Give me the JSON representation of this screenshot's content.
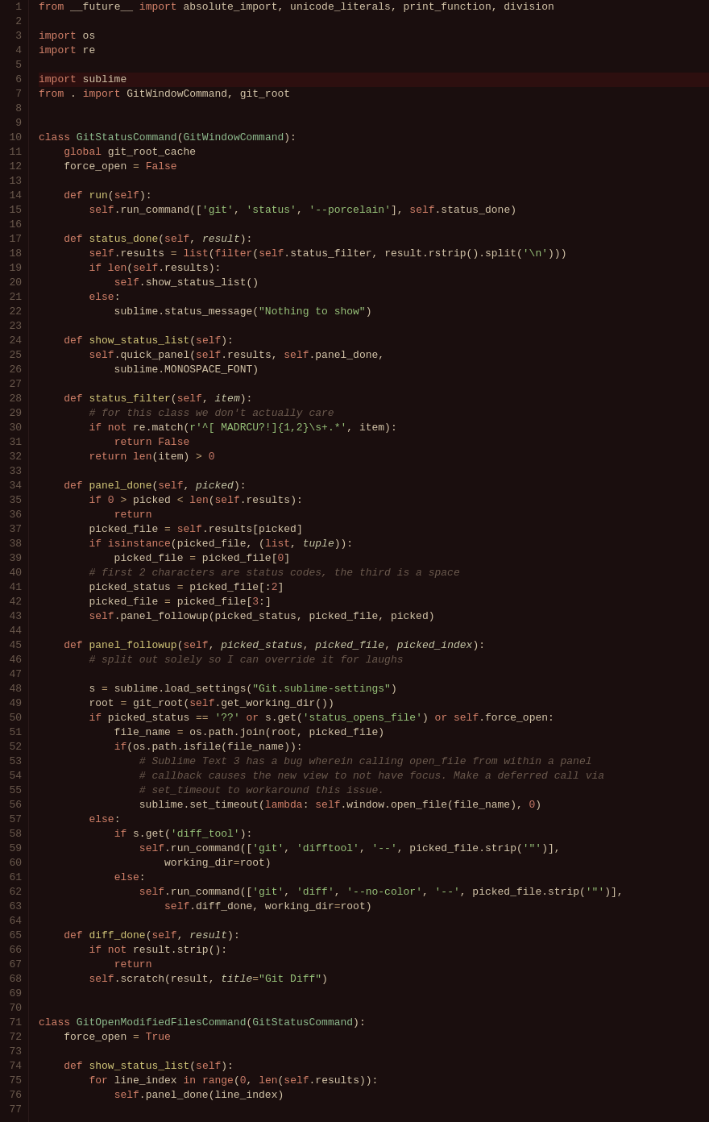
{
  "lines": [
    {
      "num": 1,
      "html": "<span class='kw'>from</span> __future__ <span class='kw'>import</span> absolute_import, unicode_literals, print_function, division",
      "highlight": false
    },
    {
      "num": 2,
      "html": "",
      "highlight": false
    },
    {
      "num": 3,
      "html": "<span class='kw'>import</span> os",
      "highlight": false
    },
    {
      "num": 4,
      "html": "<span class='kw'>import</span> re",
      "highlight": false
    },
    {
      "num": 5,
      "html": "",
      "highlight": false
    },
    {
      "num": 6,
      "html": "<span class='kw'>import</span> sublime",
      "highlight": true
    },
    {
      "num": 7,
      "html": "<span class='kw'>from</span> . <span class='kw'>import</span> GitWindowCommand, git_root",
      "highlight": false
    },
    {
      "num": 8,
      "html": "",
      "highlight": false
    },
    {
      "num": 9,
      "html": "",
      "highlight": false
    },
    {
      "num": 10,
      "html": "<span class='kw'>class</span> <span class='cn'>GitStatusCommand</span>(<span class='cn'>GitWindowCommand</span>):",
      "highlight": false
    },
    {
      "num": 11,
      "html": "    <span class='kw'>global</span> git_root_cache",
      "highlight": false
    },
    {
      "num": 12,
      "html": "    force_open <span class='op'>=</span> <span class='bool'>False</span>",
      "highlight": false
    },
    {
      "num": 13,
      "html": "",
      "highlight": false
    },
    {
      "num": 14,
      "html": "    <span class='kw'>def</span> <span class='fn'>run</span>(<span class='self-kw'>self</span>):",
      "highlight": false
    },
    {
      "num": 15,
      "html": "        <span class='self-kw'>self</span>.run_command([<span class='str'>'git'</span>, <span class='str'>'status'</span>, <span class='str'>'--porcelain'</span>], <span class='self-kw'>self</span>.status_done)",
      "highlight": false
    },
    {
      "num": 16,
      "html": "",
      "highlight": false
    },
    {
      "num": 17,
      "html": "    <span class='kw'>def</span> <span class='fn'>status_done</span>(<span class='self-kw'>self</span>, <span class='param'>result</span>):",
      "highlight": false
    },
    {
      "num": 18,
      "html": "        <span class='self-kw'>self</span>.results <span class='op'>=</span> <span class='bi'>list</span>(<span class='bi'>filter</span>(<span class='self-kw'>self</span>.status_filter, result.rstrip().split(<span class='str'>'\\n'</span>)))",
      "highlight": false
    },
    {
      "num": 19,
      "html": "        <span class='kw'>if</span> <span class='bi'>len</span>(<span class='self-kw'>self</span>.results):",
      "highlight": false
    },
    {
      "num": 20,
      "html": "            <span class='self-kw'>self</span>.show_status_list()",
      "highlight": false
    },
    {
      "num": 21,
      "html": "        <span class='kw'>else</span>:",
      "highlight": false
    },
    {
      "num": 22,
      "html": "            sublime.status_message(<span class='str'>\"Nothing to show\"</span>)",
      "highlight": false
    },
    {
      "num": 23,
      "html": "",
      "highlight": false
    },
    {
      "num": 24,
      "html": "    <span class='kw'>def</span> <span class='fn'>show_status_list</span>(<span class='self-kw'>self</span>):",
      "highlight": false
    },
    {
      "num": 25,
      "html": "        <span class='self-kw'>self</span>.quick_panel(<span class='self-kw'>self</span>.results, <span class='self-kw'>self</span>.panel_done,",
      "highlight": false
    },
    {
      "num": 26,
      "html": "            sublime.MONOSPACE_FONT)",
      "highlight": false
    },
    {
      "num": 27,
      "html": "",
      "highlight": false
    },
    {
      "num": 28,
      "html": "    <span class='kw'>def</span> <span class='fn'>status_filter</span>(<span class='self-kw'>self</span>, <span class='param'>item</span>):",
      "highlight": false
    },
    {
      "num": 29,
      "html": "        <span class='cm'># for this class we don't actually care</span>",
      "highlight": false
    },
    {
      "num": 30,
      "html": "        <span class='kw'>if not</span> re.match(<span class='str'>r'^[ MADRCU?!]{1,2}\\s+.*'</span>, item):",
      "highlight": false
    },
    {
      "num": 31,
      "html": "            <span class='kw'>return</span> <span class='bool'>False</span>",
      "highlight": false
    },
    {
      "num": 32,
      "html": "        <span class='kw'>return</span> <span class='bi'>len</span>(item) <span class='op'>&gt;</span> <span class='num'>0</span>",
      "highlight": false
    },
    {
      "num": 33,
      "html": "",
      "highlight": false
    },
    {
      "num": 34,
      "html": "    <span class='kw'>def</span> <span class='fn'>panel_done</span>(<span class='self-kw'>self</span>, <span class='param'>picked</span>):",
      "highlight": false
    },
    {
      "num": 35,
      "html": "        <span class='kw'>if</span> <span class='num'>0</span> <span class='op'>&gt;</span> picked <span class='op'>&lt;</span> <span class='bi'>len</span>(<span class='self-kw'>self</span>.results):",
      "highlight": false
    },
    {
      "num": 36,
      "html": "            <span class='kw'>return</span>",
      "highlight": false
    },
    {
      "num": 37,
      "html": "        picked_file <span class='op'>=</span> <span class='self-kw'>self</span>.results[picked]",
      "highlight": false
    },
    {
      "num": 38,
      "html": "        <span class='kw'>if</span> <span class='bi'>isinstance</span>(picked_file, (<span class='bi'>list</span>, <span class='param'>tuple</span>)):",
      "highlight": false
    },
    {
      "num": 39,
      "html": "            picked_file <span class='op'>=</span> picked_file[<span class='num'>0</span>]",
      "highlight": false
    },
    {
      "num": 40,
      "html": "        <span class='cm'># first 2 characters are status codes, the third is a space</span>",
      "highlight": false
    },
    {
      "num": 41,
      "html": "        picked_status <span class='op'>=</span> picked_file[:<span class='num'>2</span>]",
      "highlight": false
    },
    {
      "num": 42,
      "html": "        picked_file <span class='op'>=</span> picked_file[<span class='num'>3</span>:]",
      "highlight": false
    },
    {
      "num": 43,
      "html": "        <span class='self-kw'>self</span>.panel_followup(picked_status, picked_file, picked)",
      "highlight": false
    },
    {
      "num": 44,
      "html": "",
      "highlight": false
    },
    {
      "num": 45,
      "html": "    <span class='kw'>def</span> <span class='fn'>panel_followup</span>(<span class='self-kw'>self</span>, <span class='param'>picked_status</span>, <span class='param'>picked_file</span>, <span class='param'>picked_index</span>):",
      "highlight": false
    },
    {
      "num": 46,
      "html": "        <span class='cm'># split out solely so I can override it for laughs</span>",
      "highlight": false
    },
    {
      "num": 47,
      "html": "",
      "highlight": false
    },
    {
      "num": 48,
      "html": "        s <span class='op'>=</span> sublime.load_settings(<span class='str'>\"Git.sublime-settings\"</span>)",
      "highlight": false
    },
    {
      "num": 49,
      "html": "        root <span class='op'>=</span> git_root(<span class='self-kw'>self</span>.get_working_dir())",
      "highlight": false
    },
    {
      "num": 50,
      "html": "        <span class='kw'>if</span> picked_status <span class='op'>==</span> <span class='str'>'??'</span> <span class='kw'>or</span> s.get(<span class='str'>'status_opens_file'</span>) <span class='kw'>or</span> <span class='self-kw'>self</span>.force_open:",
      "highlight": false
    },
    {
      "num": 51,
      "html": "            file_name <span class='op'>=</span> os.path.join(root, picked_file)",
      "highlight": false
    },
    {
      "num": 52,
      "html": "            <span class='kw'>if</span>(os.path.isfile(file_name)):",
      "highlight": false
    },
    {
      "num": 53,
      "html": "                <span class='cm'># Sublime Text 3 has a bug wherein calling open_file from within a panel</span>",
      "highlight": false
    },
    {
      "num": 54,
      "html": "                <span class='cm'># callback causes the new view to not have focus. Make a deferred call via</span>",
      "highlight": false
    },
    {
      "num": 55,
      "html": "                <span class='cm'># set_timeout to workaround this issue.</span>",
      "highlight": false
    },
    {
      "num": 56,
      "html": "                sublime.set_timeout(<span class='lambda-kw'>lambda</span>: <span class='self-kw'>self</span>.window.open_file(file_name), <span class='num'>0</span>)",
      "highlight": false
    },
    {
      "num": 57,
      "html": "        <span class='kw'>else</span>:",
      "highlight": false
    },
    {
      "num": 58,
      "html": "            <span class='kw'>if</span> s.get(<span class='str'>'diff_tool'</span>):",
      "highlight": false
    },
    {
      "num": 59,
      "html": "                <span class='self-kw'>self</span>.run_command([<span class='str'>'git'</span>, <span class='str'>'difftool'</span>, <span class='str'>'--'</span>, picked_file.strip(<span class='str'>'\"'</span>)],",
      "highlight": false
    },
    {
      "num": 60,
      "html": "                    working_dir<span class='op'>=</span>root)",
      "highlight": false
    },
    {
      "num": 61,
      "html": "            <span class='kw'>else</span>:",
      "highlight": false
    },
    {
      "num": 62,
      "html": "                <span class='self-kw'>self</span>.run_command([<span class='str'>'git'</span>, <span class='str'>'diff'</span>, <span class='str'>'--no-color'</span>, <span class='str'>'--'</span>, picked_file.strip(<span class='str'>'\"'</span>)],",
      "highlight": false
    },
    {
      "num": 63,
      "html": "                    <span class='self-kw'>self</span>.diff_done, working_dir<span class='op'>=</span>root)",
      "highlight": false
    },
    {
      "num": 64,
      "html": "",
      "highlight": false
    },
    {
      "num": 65,
      "html": "    <span class='kw'>def</span> <span class='fn'>diff_done</span>(<span class='self-kw'>self</span>, <span class='param'>result</span>):",
      "highlight": false
    },
    {
      "num": 66,
      "html": "        <span class='kw'>if not</span> result.strip():",
      "highlight": false
    },
    {
      "num": 67,
      "html": "            <span class='kw'>return</span>",
      "highlight": false
    },
    {
      "num": 68,
      "html": "        <span class='self-kw'>self</span>.scratch(result, <span class='param'>title</span><span class='op'>=</span><span class='str'>\"Git Diff\"</span>)",
      "highlight": false
    },
    {
      "num": 69,
      "html": "",
      "highlight": false
    },
    {
      "num": 70,
      "html": "",
      "highlight": false
    },
    {
      "num": 71,
      "html": "<span class='kw'>class</span> <span class='cn'>GitOpenModifiedFilesCommand</span>(<span class='cn'>GitStatusCommand</span>):",
      "highlight": false
    },
    {
      "num": 72,
      "html": "    force_open <span class='op'>=</span> <span class='bool'>True</span>",
      "highlight": false
    },
    {
      "num": 73,
      "html": "",
      "highlight": false
    },
    {
      "num": 74,
      "html": "    <span class='kw'>def</span> <span class='fn'>show_status_list</span>(<span class='self-kw'>self</span>):",
      "highlight": false
    },
    {
      "num": 75,
      "html": "        <span class='kw'>for</span> line_index <span class='kw'>in</span> <span class='bi'>range</span>(<span class='num'>0</span>, <span class='bi'>len</span>(<span class='self-kw'>self</span>.results)):",
      "highlight": false
    },
    {
      "num": 76,
      "html": "            <span class='self-kw'>self</span>.panel_done(line_index)",
      "highlight": false
    },
    {
      "num": 77,
      "html": "",
      "highlight": false
    }
  ]
}
